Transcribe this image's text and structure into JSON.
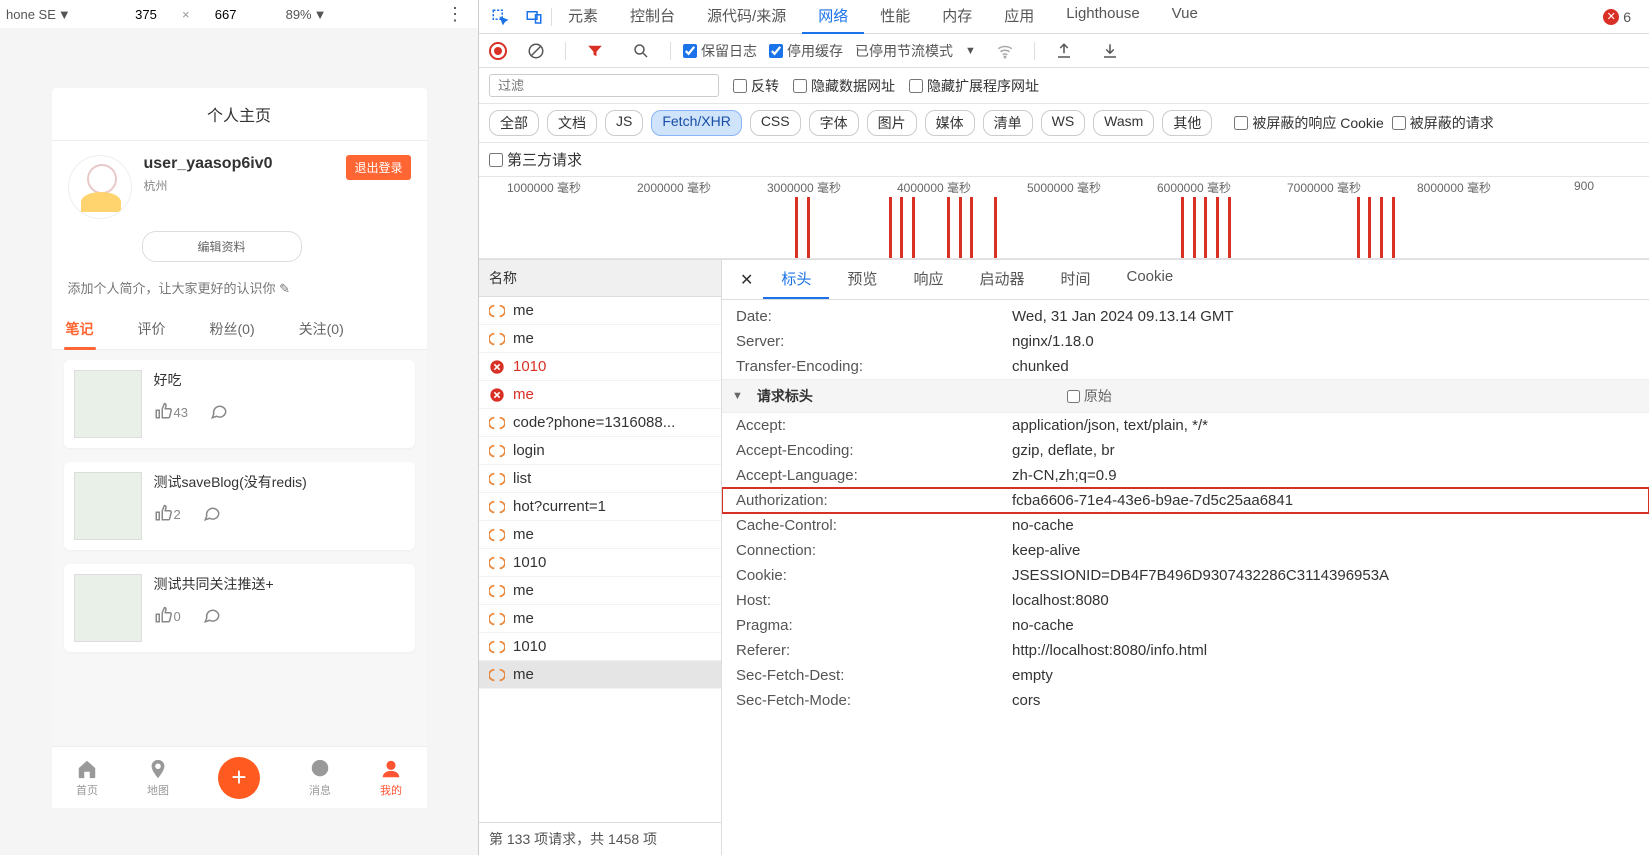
{
  "device_toolbar": {
    "device": "hone SE",
    "caret": "▼",
    "width": "375",
    "height": "667",
    "zoom": "89%",
    "zoom_caret": "▼"
  },
  "phone": {
    "header": "个人主页",
    "username": "user_yaasop6iv0",
    "location": "杭州",
    "logout": "退出登录",
    "edit_profile": "编辑资料",
    "bio_prompt": "添加个人简介，让大家更好的认识你 ✎",
    "tabs": [
      "笔记",
      "评价",
      "粉丝(0)",
      "关注(0)"
    ],
    "posts": [
      {
        "title": "好吃",
        "likes": "43"
      },
      {
        "title": "测试saveBlog(没有redis)",
        "likes": "2"
      },
      {
        "title": "测试共同关注推送+",
        "likes": "0"
      }
    ],
    "nav": {
      "home": "首页",
      "map": "地图",
      "msg": "消息",
      "me": "我的"
    }
  },
  "devtools": {
    "main_tabs": [
      "元素",
      "控制台",
      "源代码/来源",
      "网络",
      "性能",
      "内存",
      "应用",
      "Lighthouse",
      "Vue"
    ],
    "error_count": "6",
    "toolbar": {
      "preserve_log": "保留日志",
      "disable_cache": "停用缓存",
      "throttle": "已停用节流模式"
    },
    "filter_placeholder": "过滤",
    "filter_checks": {
      "invert": "反转",
      "hide_data": "隐藏数据网址",
      "hide_ext": "隐藏扩展程序网址"
    },
    "type_chips": [
      "全部",
      "文档",
      "JS",
      "Fetch/XHR",
      "CSS",
      "字体",
      "图片",
      "媒体",
      "清单",
      "WS",
      "Wasm",
      "其他"
    ],
    "extra_checks": {
      "blocked_cookie": "被屏蔽的响应 Cookie",
      "blocked_req": "被屏蔽的请求"
    },
    "third_party": "第三方请求",
    "timeline_labels": [
      "1000000 毫秒",
      "2000000 毫秒",
      "3000000 毫秒",
      "4000000 毫秒",
      "5000000 毫秒",
      "6000000 毫秒",
      "7000000 毫秒",
      "8000000 毫秒",
      "900"
    ],
    "name_col": "名称",
    "requests": [
      {
        "name": "me",
        "type": "xhr"
      },
      {
        "name": "me",
        "type": "xhr"
      },
      {
        "name": "1010",
        "type": "error"
      },
      {
        "name": "me",
        "type": "error"
      },
      {
        "name": "code?phone=1316088...",
        "type": "xhr"
      },
      {
        "name": "login",
        "type": "xhr"
      },
      {
        "name": "list",
        "type": "xhr"
      },
      {
        "name": "hot?current=1",
        "type": "xhr"
      },
      {
        "name": "me",
        "type": "xhr"
      },
      {
        "name": "1010",
        "type": "xhr"
      },
      {
        "name": "me",
        "type": "xhr"
      },
      {
        "name": "me",
        "type": "xhr"
      },
      {
        "name": "1010",
        "type": "xhr"
      },
      {
        "name": "me",
        "type": "xhr",
        "selected": true
      }
    ],
    "footer": "第 133 项请求，共 1458 项",
    "detail_tabs": [
      "标头",
      "预览",
      "响应",
      "启动器",
      "时间",
      "Cookie"
    ],
    "request_headers_title": "请求标头",
    "raw_label": "原始",
    "response_headers": [
      {
        "k": "Date:",
        "v": "Wed, 31 Jan 2024 09.13.14 GMT"
      },
      {
        "k": "Server:",
        "v": "nginx/1.18.0"
      },
      {
        "k": "Transfer-Encoding:",
        "v": "chunked"
      }
    ],
    "headers": [
      {
        "k": "Accept:",
        "v": "application/json, text/plain, */*"
      },
      {
        "k": "Accept-Encoding:",
        "v": "gzip, deflate, br"
      },
      {
        "k": "Accept-Language:",
        "v": "zh-CN,zh;q=0.9"
      },
      {
        "k": "Authorization:",
        "v": "fcba6606-71e4-43e6-b9ae-7d5c25aa6841",
        "hl": true
      },
      {
        "k": "Cache-Control:",
        "v": "no-cache"
      },
      {
        "k": "Connection:",
        "v": "keep-alive"
      },
      {
        "k": "Cookie:",
        "v": "JSESSIONID=DB4F7B496D9307432286C3114396953A"
      },
      {
        "k": "Host:",
        "v": "localhost:8080"
      },
      {
        "k": "Pragma:",
        "v": "no-cache"
      },
      {
        "k": "Referer:",
        "v": "http://localhost:8080/info.html"
      },
      {
        "k": "Sec-Fetch-Dest:",
        "v": "empty"
      },
      {
        "k": "Sec-Fetch-Mode:",
        "v": "cors"
      }
    ]
  }
}
